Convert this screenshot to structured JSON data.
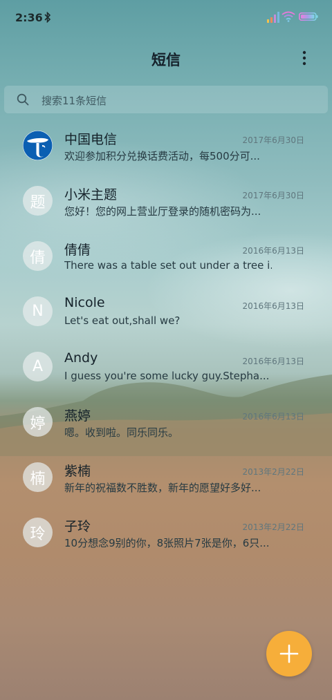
{
  "status_bar": {
    "time": "2:36",
    "icons": [
      "bluetooth-icon",
      "signal-icon",
      "wifi-icon",
      "battery-icon"
    ]
  },
  "header": {
    "title": "短信",
    "menu_icon": "more-vert-icon"
  },
  "search": {
    "placeholder": "搜索11条短信",
    "icon": "search-icon"
  },
  "messages": [
    {
      "name": "中国电信",
      "date": "2017年6月30日",
      "preview": "欢迎参加积分兑换话费活动，每500分可...",
      "avatar": "china-telecom-logo"
    },
    {
      "name": "小米主题",
      "date": "2017年6月30日",
      "preview": "您好！您的网上营业厅登录的随机密码为...",
      "avatar": "题"
    },
    {
      "name": "倩倩",
      "date": "2016年6月13日",
      "preview": "There was a table set out under a tree i...",
      "avatar": "倩"
    },
    {
      "name": "Nicole",
      "date": "2016年6月13日",
      "preview": "Let's eat out,shall we?",
      "avatar": "N"
    },
    {
      "name": "Andy",
      "date": "2016年6月13日",
      "preview": "I guess you're some lucky guy.Stepha...",
      "avatar": "A"
    },
    {
      "name": "燕婷",
      "date": "2016年6月13日",
      "preview": "嗯。收到啦。同乐同乐。",
      "avatar": "婷"
    },
    {
      "name": "紫楠",
      "date": "2013年2月22日",
      "preview": "新年的祝福数不胜数，新年的愿望好多好...",
      "avatar": "楠"
    },
    {
      "name": "子玲",
      "date": "2013年2月22日",
      "preview": "10分想念9别的你，8张照片7张是你，6只...",
      "avatar": "玲"
    }
  ],
  "fab": {
    "icon": "plus-icon",
    "color": "#F6AE3A"
  },
  "colors": {
    "accent": "#F6AE3A",
    "telecom_blue": "#0B5FB2"
  }
}
